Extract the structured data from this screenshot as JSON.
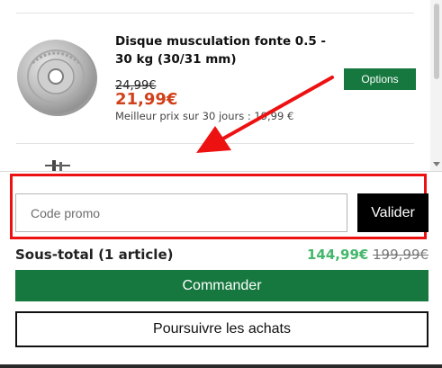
{
  "product": {
    "title": "Disque musculation fonte 0.5 - 30 kg (30/31 mm)",
    "old_price": "24,99€",
    "price": "21,99€",
    "best_price_note": "Meilleur prix sur 30 jours : 19,99 €",
    "options_label": "Options",
    "image_icon": "weight-plate-icon"
  },
  "promo": {
    "placeholder": "Code promo",
    "value": "",
    "validate_label": "Valider"
  },
  "summary": {
    "subtotal_label": "Sous-total (1 article)",
    "subtotal_price": "144,99€",
    "subtotal_old_price": "199,99€"
  },
  "actions": {
    "checkout_label": "Commander",
    "continue_label": "Poursuivre les achats"
  },
  "colors": {
    "accent_green": "#16783f",
    "price_red": "#d0401b",
    "subtotal_green": "#45b76a",
    "annotation_red": "#ee1111"
  },
  "icons": {
    "annotation": "arrow-icon",
    "scroll_down": "scroll-down-arrow-icon"
  }
}
